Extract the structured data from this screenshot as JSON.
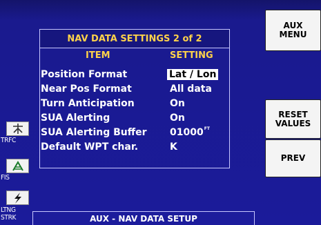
{
  "softkeys": {
    "aux_menu": [
      "AUX",
      "MENU"
    ],
    "reset_values": [
      "RESET",
      "VALUES"
    ],
    "prev": "PREV"
  },
  "panel": {
    "title": "NAV DATA SETTINGS  2 of 2",
    "header_item": "ITEM",
    "header_setting": "SETTING",
    "rows": [
      {
        "label": "Position Format",
        "value": "Lat / Lon",
        "selected": true
      },
      {
        "label": "Near Pos Format",
        "value": "All data"
      },
      {
        "label": "Turn Anticipation",
        "value": "On"
      },
      {
        "label": "SUA Alerting",
        "value": "On"
      },
      {
        "label": "SUA Alerting Buffer",
        "value": "01000",
        "unit": "FT"
      },
      {
        "label": "Default WPT char.",
        "value": "K"
      }
    ]
  },
  "side": {
    "trfc": "TRFC",
    "fis": "FIS",
    "ltng": [
      "LTNG",
      "STRK"
    ]
  },
  "status": "AUX - NAV DATA SETUP",
  "colors": {
    "background": "#1b1b9a",
    "title_text": "#ffd24a",
    "key_bg": "#f4f4f4"
  }
}
